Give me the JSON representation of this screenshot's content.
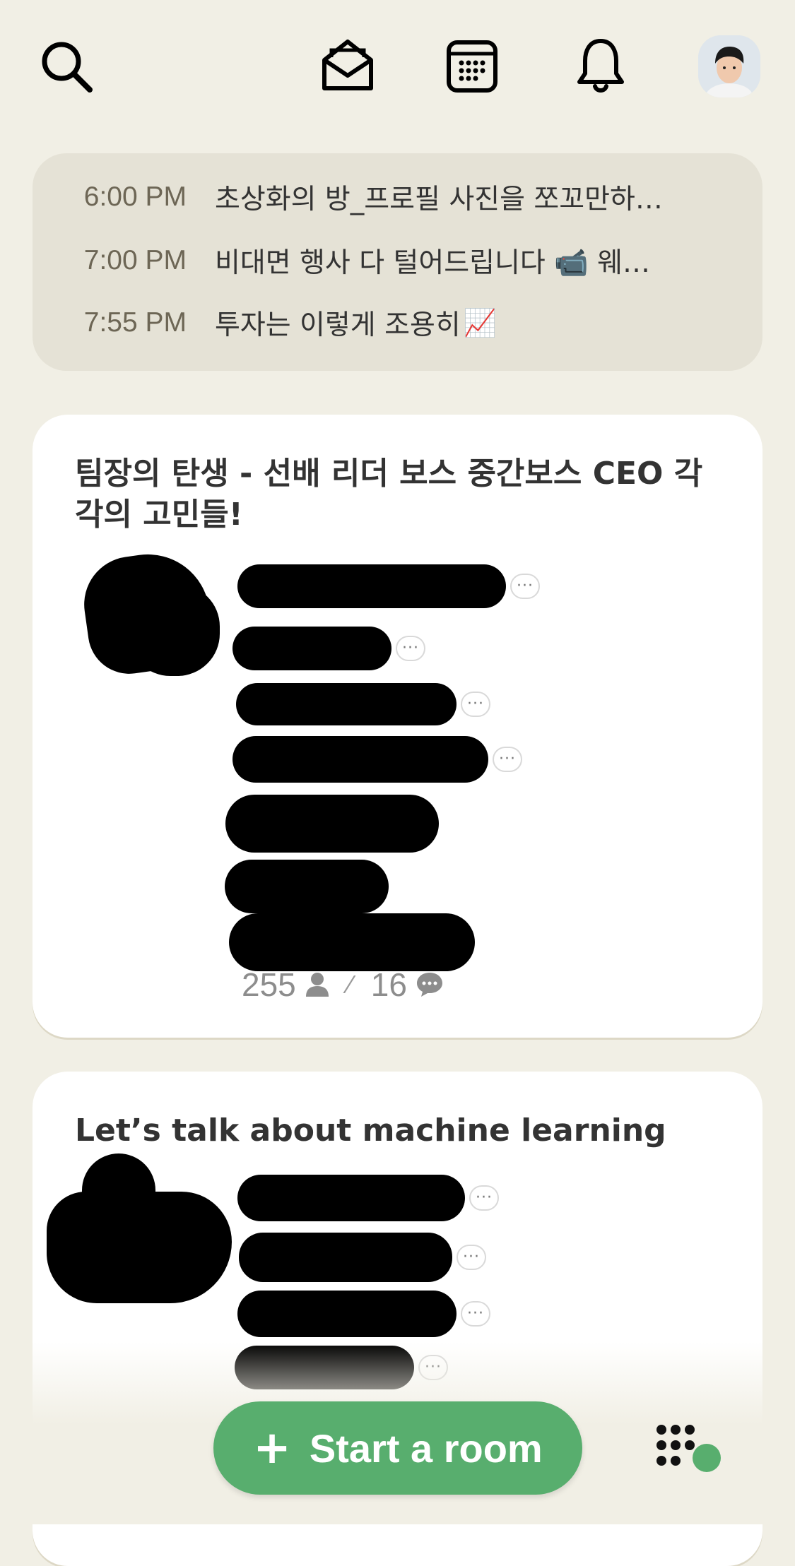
{
  "topbar": {
    "icons": [
      "search-icon",
      "invite-envelope-icon",
      "calendar-icon",
      "bell-icon",
      "profile-avatar"
    ]
  },
  "upcoming": [
    {
      "time": "6:00 PM",
      "title": "초상화의 방_프로필 사진을 쪼꼬만하…"
    },
    {
      "time": "7:00 PM",
      "title": "비대면 행사 다 털어드립니다 📹 웨…"
    },
    {
      "time": "7:55 PM",
      "title": "투자는 이렇게 조용히",
      "emoji": "📈"
    }
  ],
  "rooms": [
    {
      "title": "팀장의 탄생 - 선배 리더 보스 중간보스 CEO 각각의 고민들!",
      "listeners": "255",
      "speakers": "16"
    },
    {
      "title": "Let’s talk about machine learning"
    }
  ],
  "bottom": {
    "start_room_label": "Start a room",
    "start_room_plus": "+"
  },
  "colors": {
    "background": "#f1efe5",
    "events_bg": "#e5e2d6",
    "card_bg": "#ffffff",
    "accent_green": "#58ae6e"
  }
}
